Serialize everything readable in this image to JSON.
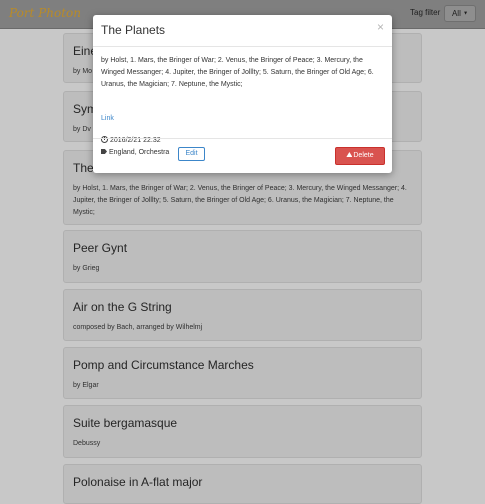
{
  "navbar": {
    "brand": "Port Photon",
    "tag_filter_label": "Tag filter",
    "tag_filter_value": "All",
    "caret": "▼"
  },
  "cards": [
    {
      "title": "Eine",
      "subtitle": "by Mo"
    },
    {
      "title": "Sym",
      "subtitle": "by Dv"
    },
    {
      "title": "The",
      "subtitle": "by Holst, 1. Mars, the Bringer of War; 2. Venus, the Bringer of Peace; 3. Mercury, the Winged Messanger; 4. Jupiter, the Bringer of Jolllty; 5. Saturn, the Bringer of Old Age; 6. Uranus, the Magician; 7. Neptune, the Mystic;"
    },
    {
      "title": "Peer Gynt",
      "subtitle": "by Grieg"
    },
    {
      "title": "Air on the G String",
      "subtitle": "composed by Bach, arranged by Wilhelmj"
    },
    {
      "title": "Pomp and Circumstance Marches",
      "subtitle": "by Elgar"
    },
    {
      "title": "Suite bergamasque",
      "subtitle": "Debussy"
    },
    {
      "title": "Polonaise in A-flat major",
      "subtitle": ""
    }
  ],
  "modal": {
    "title": "The Planets",
    "close": "×",
    "description": "by Holst, 1. Mars, the Bringer of War; 2. Venus, the Bringer of Peace; 3. Mercury, the Winged Messanger; 4. Jupiter, the Bringer of Jolllty; 5. Saturn, the Bringer of Old Age; 6. Uranus, the Magician; 7. Neptune, the Mystic;",
    "link_label": "Link",
    "timestamp": "2016/2/21 22:32",
    "tags": "England, Orchestra",
    "edit_label": "Edit",
    "delete_label": "Delete"
  },
  "icons": {
    "clock": "clock-icon",
    "tag": "tag-icon",
    "warning": "warning-icon",
    "close": "close-icon"
  },
  "colors": {
    "brand": "#b98b28",
    "link": "#3c86c9",
    "danger": "#d9534f"
  }
}
